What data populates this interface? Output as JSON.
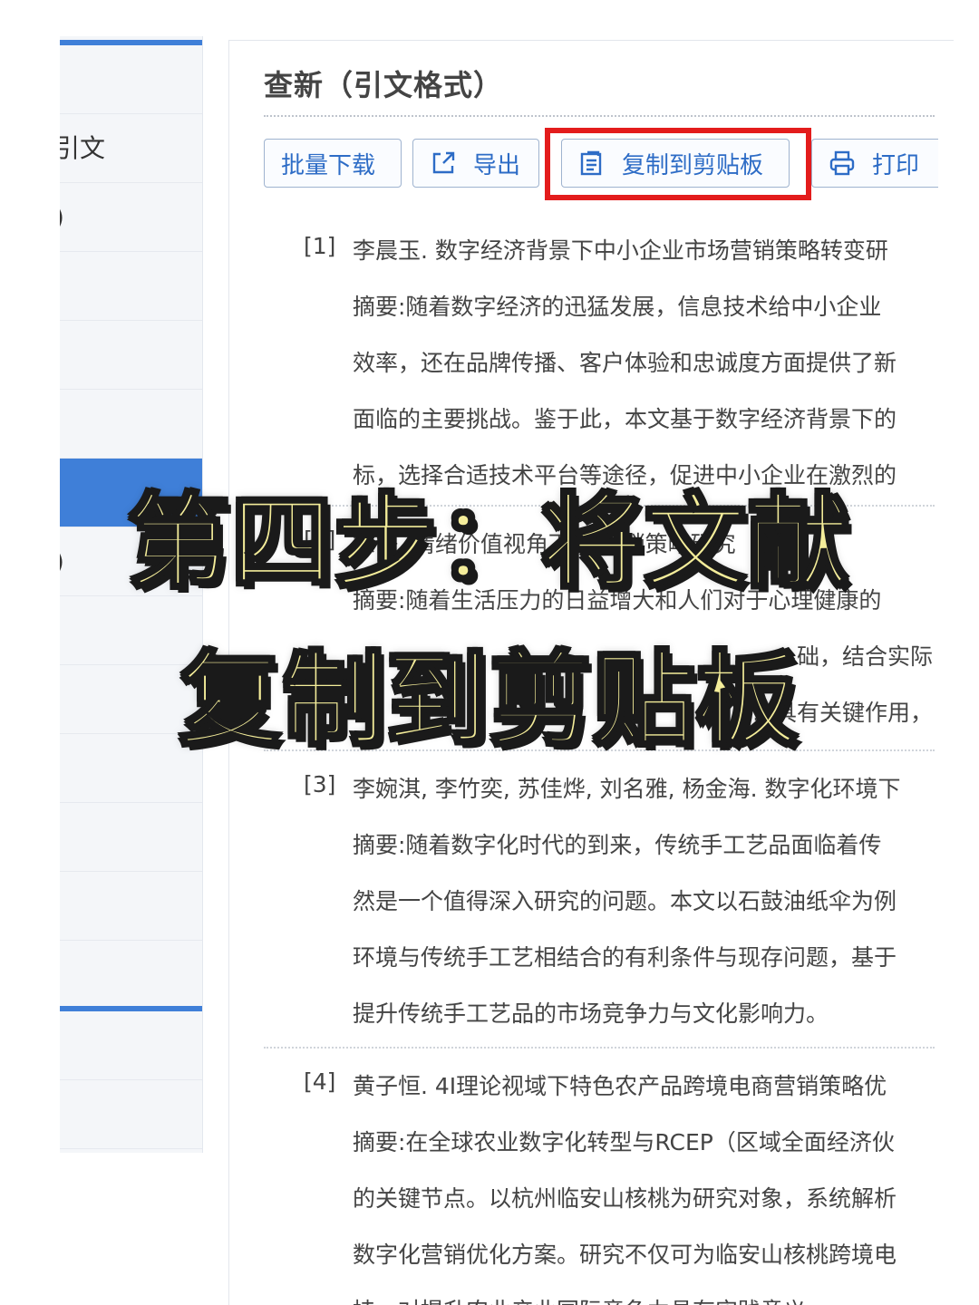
{
  "sidebar": {
    "items": [
      {
        "label": ""
      },
      {
        "label": "引文"
      },
      {
        "label": ")"
      },
      {
        "label": ""
      },
      {
        "label": ""
      },
      {
        "label": ""
      },
      {
        "label": ""
      },
      {
        "label": ")"
      },
      {
        "label": ""
      },
      {
        "label": ""
      },
      {
        "label": ""
      },
      {
        "label": ""
      },
      {
        "label": ""
      },
      {
        "label": ""
      },
      {
        "label": ""
      },
      {
        "label": ""
      }
    ]
  },
  "panel": {
    "title": "查新（引文格式）"
  },
  "toolbar": {
    "batch_download": "批量下载",
    "export": "导出",
    "copy_clipboard": "复制到剪贴板",
    "print": "打印"
  },
  "references": [
    {
      "num": "[1]",
      "lines": [
        "李晨玉. 数字经济背景下中小企业市场营销策略转变研",
        "摘要:随着数字经济的迅猛发展，信息技术给中小企业",
        "效率，还在品牌传播、客户体验和忠诚度方面提供了新",
        "面临的主要挑战。鉴于此，本文基于数字经济背景下的",
        "标，选择合适技术平台等途径，促进中小企业在激烈的"
      ]
    },
    {
      "num": "[2]",
      "lines": [
        "徐静. 情绪价值视角下... 营销策略研究",
        "摘要:随着生活压力的日益增大和人们对于心理健康的",
        "...础，结合实际",
        "...具有关键作用，"
      ]
    },
    {
      "num": "[3]",
      "lines": [
        "李婉淇, 李竹奕, 苏佳烨, 刘名雅, 杨金海. 数字化环境下",
        "摘要:随着数字化时代的到来，传统手工艺品面临着传",
        "然是一个值得深入研究的问题。本文以石鼓油纸伞为例",
        "环境与传统手工艺相结合的有利条件与现存问题，基于",
        "提升传统手工艺品的市场竞争力与文化影响力。"
      ]
    },
    {
      "num": "[4]",
      "lines": [
        "黄子恒. 4I理论视域下特色农产品跨境电商营销策略优",
        "摘要:在全球农业数字化转型与RCEP（区域全面经济伙",
        "的关键节点。以杭州临安山核桃为研究对象，系统解析",
        "数字化营销优化方案。研究不仅可为临安山核桃跨境电",
        "持，对提升农业产业国际竞争力具有实践意义。"
      ]
    }
  ],
  "caption": {
    "line1": "第四步：将文献",
    "line2": "复制到剪贴板"
  },
  "colors": {
    "accent": "#3f7fd8",
    "button_text": "#2d6cc6",
    "highlight": "#e31c1c",
    "caption_fill": "#f4ed9a"
  }
}
